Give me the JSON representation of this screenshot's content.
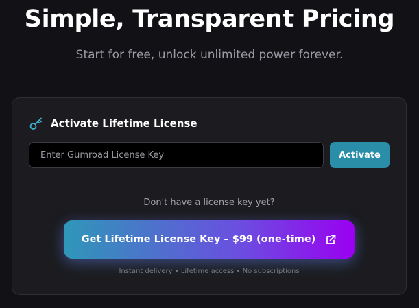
{
  "header": {
    "title": "Simple, Transparent Pricing",
    "subtitle": "Start for free, unlock unlimited power forever."
  },
  "license_card": {
    "title": "Activate Lifetime License",
    "title_icon": "key-icon",
    "input_placeholder": "Enter Gumroad License Key",
    "input_value": "",
    "activate_label": "Activate",
    "no_key_prompt": "Don't have a license key yet?",
    "buy_label": "Get Lifetime License Key – $99 (one-time)",
    "buy_icon": "external-link-icon",
    "footnote": "Instant delivery • Lifetime access • No subscriptions"
  },
  "colors": {
    "background": "#121216",
    "card": "#1c1c20",
    "accent": "#2a8ea8",
    "gradient_start": "#2f97b8",
    "gradient_end": "#9a00f0",
    "key_icon": "#3fb0d0"
  }
}
